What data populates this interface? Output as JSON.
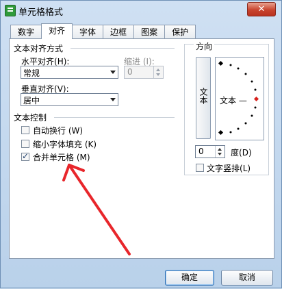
{
  "window": {
    "title": "单元格格式",
    "close_symbol": "✕"
  },
  "tabs": [
    "数字",
    "对齐",
    "字体",
    "边框",
    "图案",
    "保护"
  ],
  "active_tab": "对齐",
  "alignment": {
    "group_title": "文本对齐方式",
    "horizontal_label": "水平对齐",
    "horizontal_hotkey": "(H):",
    "horizontal_value": "常规",
    "indent_label": "缩进",
    "indent_hotkey": "(I):",
    "indent_value": "0",
    "vertical_label": "垂直对齐",
    "vertical_hotkey": "(V):",
    "vertical_value": "居中"
  },
  "text_control": {
    "group_title": "文本控制",
    "options": [
      {
        "label": "自动换行",
        "hotkey": "(W)",
        "checked": false
      },
      {
        "label": "缩小字体填充",
        "hotkey": "(K)",
        "checked": false
      },
      {
        "label": "合并单元格",
        "hotkey": "(M)",
        "checked": true
      }
    ]
  },
  "orientation": {
    "group_title": "方向",
    "vertical_text_button": "文本",
    "dial_text": "文本 —",
    "degrees_value": "0",
    "degrees_label": "度",
    "degrees_hotkey": "(D)",
    "vertical_text_label": "文字竖排",
    "vertical_text_hotkey": "(L)",
    "vertical_text_checked": false
  },
  "buttons": {
    "ok": "确定",
    "cancel": "取消"
  },
  "colors": {
    "title_bar": "#cfe0f3",
    "close_button": "#c9442f",
    "annotation_arrow": "#e8262b",
    "dial_marker": "#d8201c"
  }
}
